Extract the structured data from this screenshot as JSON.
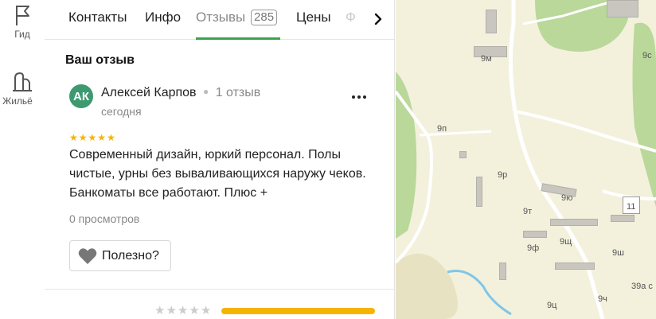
{
  "rail": {
    "items": [
      {
        "label": "Гид",
        "icon": "flag-icon"
      },
      {
        "label": "Жильё",
        "icon": "house-icon"
      }
    ]
  },
  "tabs": {
    "items": [
      {
        "label": "Контакты"
      },
      {
        "label": "Инфо"
      },
      {
        "label": "Отзывы",
        "count": "285",
        "active": true
      },
      {
        "label": "Цены"
      }
    ],
    "faded_label": "Ф",
    "next_icon": "chevron-right-icon"
  },
  "section_title": "Ваш отзыв",
  "review": {
    "avatar_initials": "АК",
    "avatar_color": "#3d9970",
    "author": "Алексей Карпов",
    "author_reviews": "1 отзыв",
    "date": "сегодня",
    "rating": 5,
    "text": "Современный дизайн, юркий персонал. Полы чистые, урны без вываливающихся наружу чеков. Банкоматы все работают. Плюс +",
    "views": "0 просмотров",
    "helpful_label": "Полезно?"
  },
  "rate_summary": {
    "rating": 0,
    "bar_color": "#f5b400",
    "bar_fraction": 1.0
  },
  "map": {
    "labels": [
      "9м",
      "9р",
      "9п",
      "9ю",
      "11",
      "9т",
      "9ф",
      "9щ",
      "9ш",
      "9ц",
      "9ч",
      "39а с",
      "9с"
    ]
  },
  "colors": {
    "accent_green": "#3ca44b",
    "star_yellow": "#f5b400"
  }
}
